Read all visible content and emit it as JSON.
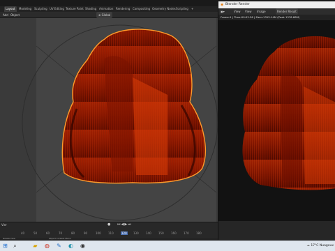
{
  "blender": {
    "workspace_tabs": [
      "Layout",
      "Modeling",
      "Sculpting",
      "UV Editing",
      "Texture Paint",
      "Shading",
      "Animation",
      "Rendering",
      "Compositing",
      "Geometry Nodes",
      "Scripting",
      "+"
    ],
    "active_tab": "Layout",
    "toolbar": {
      "add": "Add",
      "object": "Object",
      "global": "Global"
    },
    "timeline_ruler": [
      "40",
      "50",
      "60",
      "70",
      "80",
      "90",
      "100",
      "110",
      "120",
      "130",
      "140",
      "150",
      "160",
      "170",
      "180"
    ],
    "timeline_left": "Vier",
    "status_left": "Rotate View",
    "status_mid": "Object Context Menu"
  },
  "render_window": {
    "title": "Blender Render",
    "menu": {
      "view": "View",
      "view2": "View",
      "image": "Image",
      "slot_label": "Render Result"
    },
    "info": "Frame:1 | Time:00:02.56 | Mem:1315.14M (Peak 1376.68M)"
  },
  "taskbar": {
    "temperature": "17°C",
    "weather": "Nuageux",
    "icons": [
      "windows-icon",
      "search-icon",
      "file-explorer-icon",
      "chrome-icon",
      "paint-icon",
      "edge-icon",
      "blender-icon"
    ]
  },
  "colors": {
    "hair_dark": "#5a0a00",
    "hair_mid": "#b42300",
    "hair_light": "#e24a10",
    "selection_outline": "#ff9a2a"
  }
}
